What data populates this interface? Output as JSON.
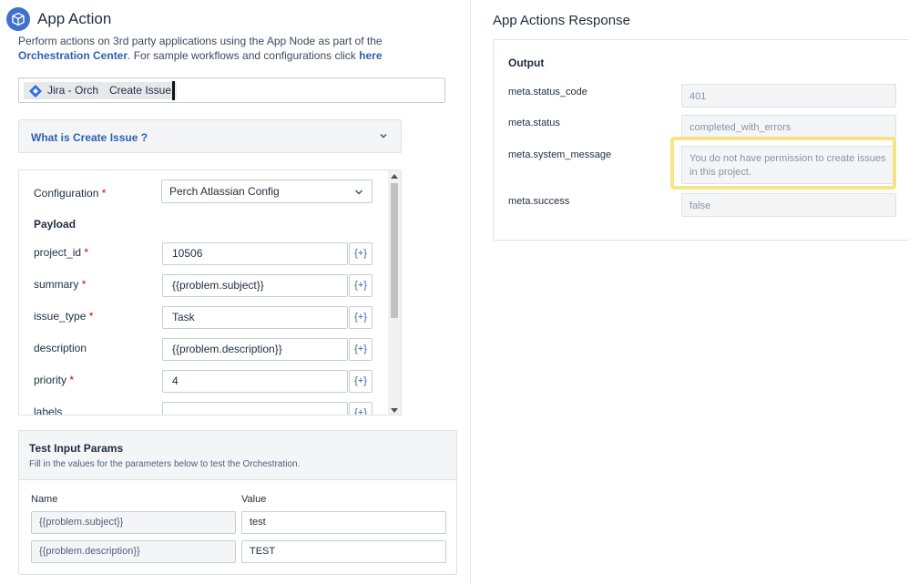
{
  "header": {
    "title": "App Action",
    "description_pre": "Perform actions on 3rd party applications using the App Node as part of the ",
    "description_link": "Orchestration Center",
    "description_mid": ". For sample workflows and configurations click ",
    "description_here": "here"
  },
  "app_select": {
    "app_chip": "Jira - Orch",
    "action_chip": "Create Issue"
  },
  "accordion": {
    "label": "What is Create Issue ?"
  },
  "configuration": {
    "label": "Configuration",
    "value": "Perch Atlassian Config"
  },
  "payload": {
    "heading": "Payload",
    "fields": [
      {
        "label": "project_id",
        "required": true,
        "value": "10506",
        "plus": "{+}"
      },
      {
        "label": "summary",
        "required": true,
        "value": "{{problem.subject}}",
        "plus": "{+}"
      },
      {
        "label": "issue_type",
        "required": true,
        "value": "Task",
        "plus": "{+}"
      },
      {
        "label": "description",
        "required": false,
        "value": "{{problem.description}}",
        "plus": "{+}"
      },
      {
        "label": "priority",
        "required": true,
        "value": "4",
        "plus": "{+}"
      },
      {
        "label": "labels",
        "required": false,
        "value": "",
        "plus": "{+}"
      }
    ]
  },
  "test_params": {
    "title": "Test Input Params",
    "subtitle": "Fill in the values for the parameters below to test the Orchestration.",
    "col_name": "Name",
    "col_value": "Value",
    "rows": [
      {
        "name": "{{problem.subject}}",
        "value": "test"
      },
      {
        "name": "{{problem.description}}",
        "value": "TEST"
      }
    ]
  },
  "response": {
    "title": "App Actions Response",
    "output_label": "Output",
    "rows": [
      {
        "key": "meta.status_code",
        "value": "401"
      },
      {
        "key": "meta.status",
        "value": "completed_with_errors"
      },
      {
        "key": "meta.system_message",
        "value": "You do not have permission to create issues in this project."
      },
      {
        "key": "meta.success",
        "value": "false"
      }
    ]
  },
  "colors": {
    "accent": "#3f6fcf",
    "link": "#2f5fb3",
    "required": "#d0021b",
    "highlight": "#f7df72"
  }
}
